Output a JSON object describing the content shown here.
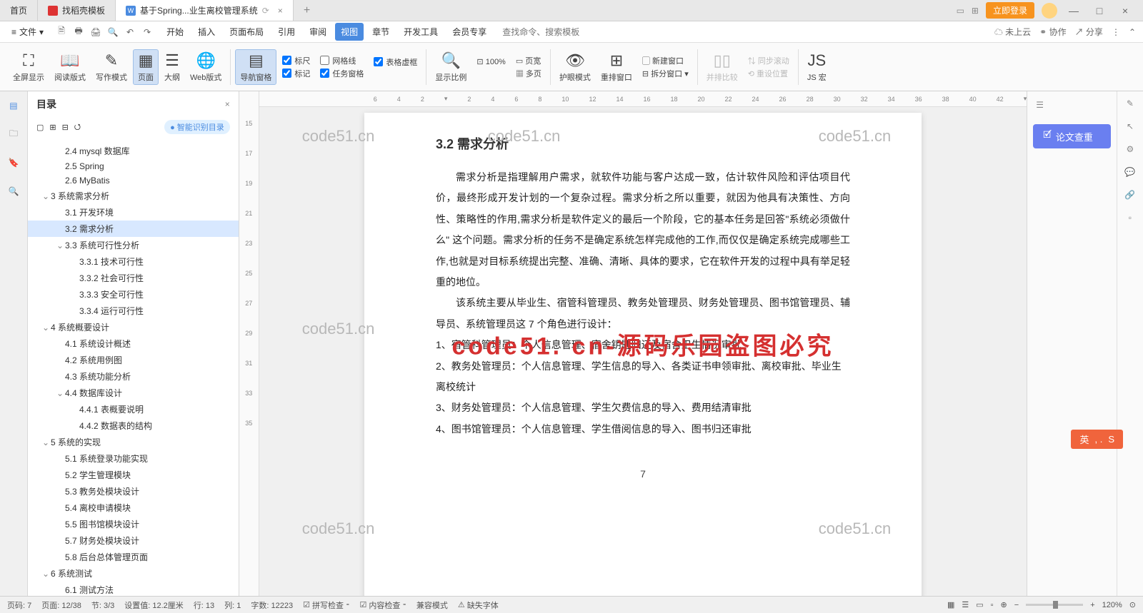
{
  "tabs": {
    "home": "首页",
    "template": "找稻壳模板",
    "doc": "基于Spring...业生离校管理系统",
    "login": "立即登录"
  },
  "menus": {
    "file": "文件",
    "items": [
      "开始",
      "插入",
      "页面布局",
      "引用",
      "审阅",
      "视图",
      "章节",
      "开发工具",
      "会员专享"
    ],
    "search_ph": "查找命令、搜索模板",
    "cloud": "未上云",
    "collab": "协作",
    "share": "分享"
  },
  "ribbon": {
    "fullscreen": "全屏显示",
    "read": "阅读版式",
    "write": "写作模式",
    "page": "页面",
    "outline": "大纲",
    "web": "Web版式",
    "nav": "导航窗格",
    "ruler": "标尺",
    "grid": "网格线",
    "tablegrid": "表格虚框",
    "mark": "标记",
    "task": "任务窗格",
    "zoom": "显示比例",
    "zoom100": "100%",
    "pagewidth": "页宽",
    "multipage": "多页",
    "eye": "护眼模式",
    "rearrange": "重排窗口",
    "newwin": "新建窗口",
    "split": "拆分窗口",
    "compare": "并排比较",
    "syncscroll": "同步滚动",
    "resetpos": "重设位置",
    "jsmacro": "JS 宏"
  },
  "sidebar": {
    "title": "目录",
    "smart": "智能识别目录",
    "toc": [
      {
        "l": 2,
        "t": "2.4 mysql 数据库"
      },
      {
        "l": 2,
        "t": "2.5 Spring"
      },
      {
        "l": 2,
        "t": "2.6 MyBatis"
      },
      {
        "l": 1,
        "t": "3 系统需求分析",
        "c": true
      },
      {
        "l": 2,
        "t": "3.1 开发环境"
      },
      {
        "l": 2,
        "t": "3.2 需求分析",
        "a": true
      },
      {
        "l": 2,
        "t": "3.3 系统可行性分析",
        "c": true
      },
      {
        "l": 3,
        "t": "3.3.1 技术可行性"
      },
      {
        "l": 3,
        "t": "3.3.2 社会可行性"
      },
      {
        "l": 3,
        "t": "3.3.3 安全可行性"
      },
      {
        "l": 3,
        "t": "3.3.4 运行可行性"
      },
      {
        "l": 1,
        "t": "4 系统概要设计",
        "c": true
      },
      {
        "l": 2,
        "t": "4.1 系统设计概述"
      },
      {
        "l": 2,
        "t": "4.2 系统用例图"
      },
      {
        "l": 2,
        "t": "4.3 系统功能分析"
      },
      {
        "l": 2,
        "t": "4.4 数据库设计",
        "c": true
      },
      {
        "l": 3,
        "t": "4.4.1 表概要说明"
      },
      {
        "l": 3,
        "t": "4.4.2 数据表的结构"
      },
      {
        "l": 1,
        "t": "5 系统的实现",
        "c": true
      },
      {
        "l": 2,
        "t": "5.1 系统登录功能实现"
      },
      {
        "l": 2,
        "t": "5.2 学生管理模块"
      },
      {
        "l": 2,
        "t": "5.3 教务处模块设计"
      },
      {
        "l": 2,
        "t": "5.4 离校申请模块"
      },
      {
        "l": 2,
        "t": "5.5 图书馆模块设计"
      },
      {
        "l": 2,
        "t": "5.7 财务处模块设计"
      },
      {
        "l": 2,
        "t": "5.8 后台总体管理页面"
      },
      {
        "l": 1,
        "t": "6 系统测试",
        "c": true
      },
      {
        "l": 2,
        "t": "6.1 测试方法"
      }
    ]
  },
  "doc": {
    "heading": "3.2 需求分析",
    "para1": "需求分析是指理解用户需求，就软件功能与客户达成一致，估计软件风险和评估项目代价，最终形成开发计划的一个复杂过程。需求分析之所以重要，就因为他具有决策性、方向性、策略性的作用,需求分析是软件定义的最后一个阶段，它的基本任务是回答\"系统必须做什么\" 这个问题。需求分析的任务不是确定系统怎样完成他的工作,而仅仅是确定系统完成哪些工作,也就是对目标系统提出完整、准确、清晰、具体的要求，它在软件开发的过程中具有举足轻重的地位。",
    "para2": "该系统主要从毕业生、宿管科管理员、教务处管理员、财务处管理员、图书馆管理员、辅导员、系统管理员这 7 个角色进行设计：",
    "l1": "1、宿管科管理员：个人信息管理、宿舍钥匙归还及宿舍卫生情况审批",
    "l2": "2、教务处管理员：个人信息管理、学生信息的导入、各类证书申领审批、离校审批、毕业生离校统计",
    "l3": "3、财务处管理员：个人信息管理、学生欠费信息的导入、费用结清审批",
    "l4": "4、图书馆管理员：个人信息管理、学生借阅信息的导入、图书归还审批",
    "pagenum": "7"
  },
  "right": {
    "check": "论文查重"
  },
  "status": {
    "page": "页码: 7",
    "pages": "页面: 12/38",
    "sec": "节: 3/3",
    "setval": "设置值: 12.2厘米",
    "row": "行: 13",
    "col": "列: 1",
    "words": "字数: 12223",
    "spell": "拼写检查",
    "content": "内容检查",
    "compat": "兼容模式",
    "missfont": "缺失字体",
    "zoom": "120%"
  },
  "wm": "code51.cn",
  "wm_red": "code51. cn-源码乐园盗图必究",
  "ime": "英"
}
